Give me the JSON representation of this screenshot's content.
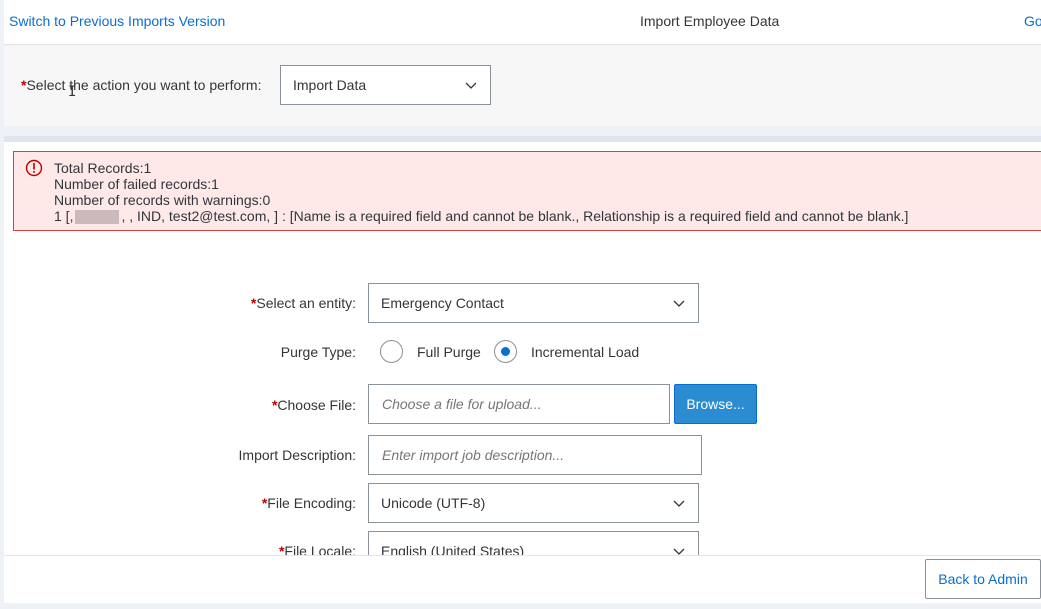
{
  "header": {
    "switch_link": "Switch to Previous Imports Version",
    "title": "Import Employee Data",
    "go_link": "Go"
  },
  "action": {
    "required_mark": "*",
    "label": "Select the action you want to perform:",
    "selected": "Import Data"
  },
  "error": {
    "line1": "Total Records:1",
    "line2": "Number of failed records:1",
    "line3": "Number of records with warnings:0",
    "line4_prefix": "1 [,",
    "line4_suffix": ", , IND, test2@test.com, ] : [Name is a required field and cannot be blank., Relationship is a required field and cannot be blank.]"
  },
  "form": {
    "entity": {
      "required_mark": "*",
      "label": "Select an entity:",
      "value": "Emergency Contact"
    },
    "purge": {
      "label": "Purge Type:",
      "options": [
        {
          "label": "Full Purge",
          "selected": false
        },
        {
          "label": "Incremental Load",
          "selected": true
        }
      ]
    },
    "file": {
      "required_mark": "*",
      "label": "Choose File:",
      "placeholder": "Choose a file for upload...",
      "browse_label": "Browse..."
    },
    "description": {
      "label": "Import Description:",
      "placeholder": "Enter import job description..."
    },
    "encoding": {
      "required_mark": "*",
      "label": "File Encoding:",
      "value": "Unicode (UTF-8)"
    },
    "locale": {
      "required_mark": "*",
      "label": "File Locale:",
      "value": "English (United States)"
    }
  },
  "footer": {
    "back_label": "Back to Admin"
  },
  "colors": {
    "accent": "#0a6ed1",
    "error_bg": "#ffe8e8",
    "error_border": "#d04343",
    "required": "#bb0000"
  }
}
